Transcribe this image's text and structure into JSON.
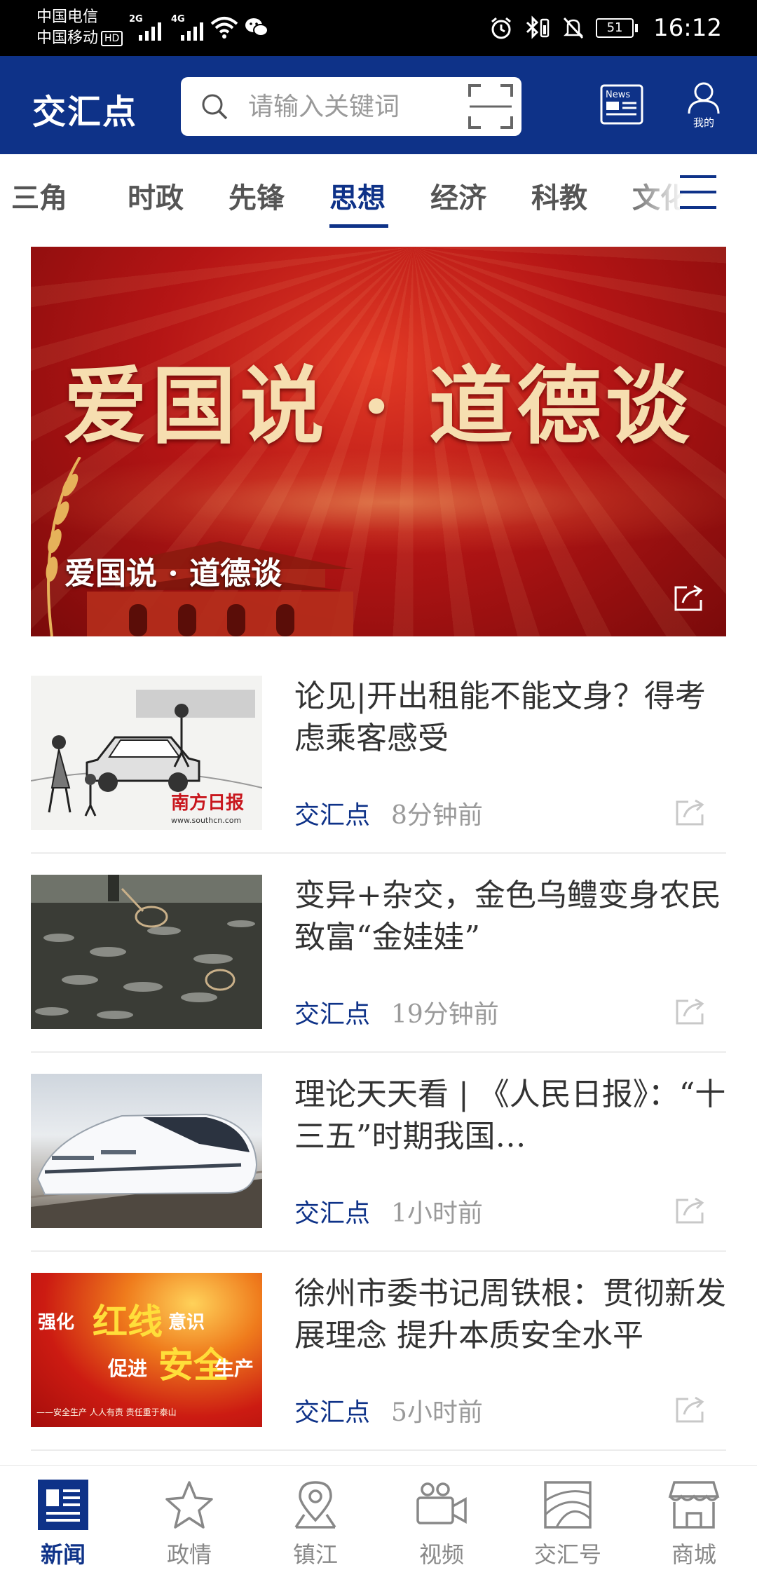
{
  "status_bar": {
    "carrier_1": "中国电信",
    "carrier_2": "中国移动",
    "hd": "HD",
    "signal_1": "2G",
    "signal_2": "4G",
    "battery": "51",
    "time": "16:12"
  },
  "header": {
    "logo": "交汇点",
    "search_placeholder": "请输入关键词",
    "news_icon_label": "News",
    "me_label": "我的"
  },
  "tabs": [
    {
      "label": "三角"
    },
    {
      "label": "时政"
    },
    {
      "label": "先锋"
    },
    {
      "label": "思想",
      "active": true
    },
    {
      "label": "经济"
    },
    {
      "label": "科教"
    },
    {
      "label": "文化"
    }
  ],
  "hero": {
    "banner_text": "爱国说 · 道德谈",
    "caption": "爱国说 · 道德谈"
  },
  "news": [
    {
      "title": "论见|开出租能不能文身？得考虑乘客感受",
      "source": "交汇点",
      "time": "8分钟前",
      "thumb_text": "南方日报",
      "thumb_sub": "www.southcn.com"
    },
    {
      "title": "变异+杂交，金色乌鳢变身农民致富“金娃娃”",
      "source": "交汇点",
      "time": "19分钟前"
    },
    {
      "title": "理论天天看 | 《人民日报》：“十三五”时期我国…",
      "source": "交汇点",
      "time": "1小时前"
    },
    {
      "title": "徐州市委书记周铁根：贯彻新发展理念 提升本质安全水平",
      "source": "交汇点",
      "time": "5小时前",
      "thumb_text": [
        "强化",
        "红线",
        "意识",
        "促进",
        "安全",
        "生产",
        "——安全生产 人人有责 责任重于泰山"
      ]
    }
  ],
  "bottom_nav": [
    {
      "label": "新闻",
      "icon": "newspaper-icon",
      "active": true
    },
    {
      "label": "政情",
      "icon": "star-icon"
    },
    {
      "label": "镇江",
      "icon": "location-pin-icon"
    },
    {
      "label": "视频",
      "icon": "video-camera-icon"
    },
    {
      "label": "交汇号",
      "icon": "jiaohuihao-icon"
    },
    {
      "label": "商城",
      "icon": "store-icon"
    }
  ],
  "colors": {
    "brand": "#0e3288",
    "source_text": "#0e3288",
    "muted": "#9a9a9a"
  }
}
